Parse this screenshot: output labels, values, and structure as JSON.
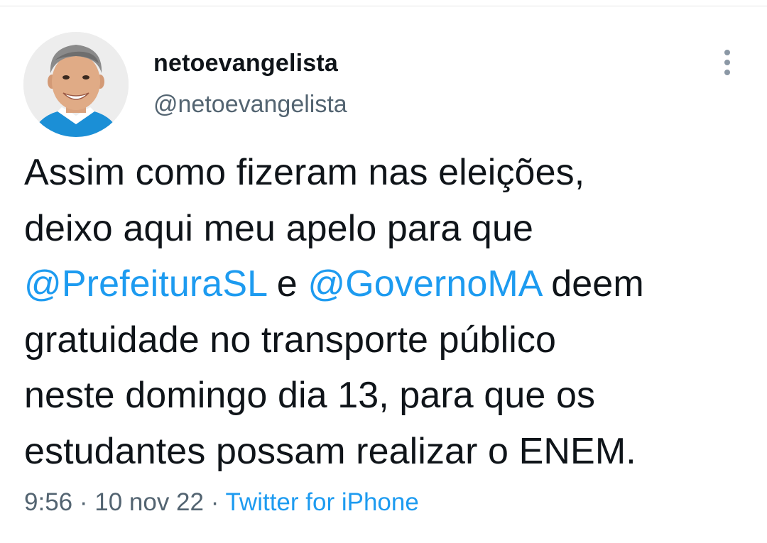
{
  "author": {
    "display_name": "netoevangelista",
    "handle": "@netoevangelista"
  },
  "tweet": {
    "line1": "Assim como fizeram nas eleições,",
    "line2": "deixo aqui meu apelo para que",
    "mention1": "@PrefeituraSL",
    "conj": " e ",
    "mention2": "@GovernoMA",
    "after_mentions": " deem",
    "line4": "gratuidade no transporte público",
    "line5": "neste domingo dia 13, para que os",
    "line6": "estudantes possam realizar o ENEM."
  },
  "meta": {
    "time": "9:56",
    "separator1": " · ",
    "date": "10 nov 22",
    "separator2": " · ",
    "source": "Twitter for iPhone"
  },
  "icons": {
    "more": "more-vertical-icon"
  },
  "colors": {
    "text": "#0f1419",
    "secondary": "#536471",
    "link": "#1d9bf0"
  }
}
